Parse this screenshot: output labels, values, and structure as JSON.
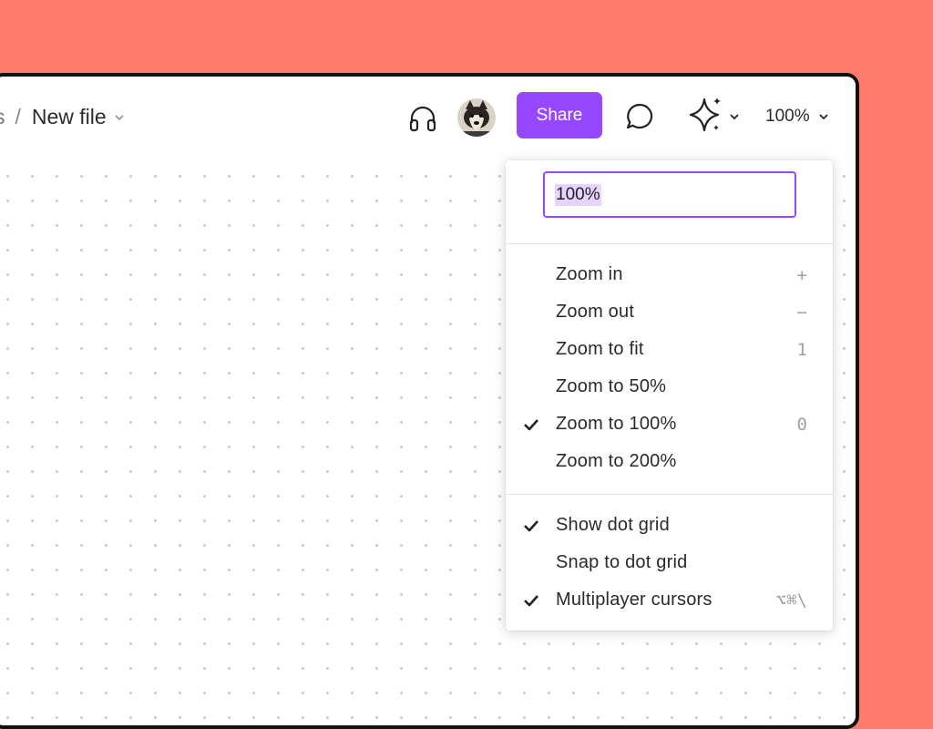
{
  "breadcrumb": {
    "previous": "s",
    "separator": "/",
    "file_name": "New file",
    "chevron_icon": "chevron-down-icon"
  },
  "toolbar": {
    "headphones_icon": "headphones-icon",
    "avatar_icon": "shiba-dog-avatar",
    "share_label": "Share",
    "comment_icon": "comment-bubble-icon",
    "ai_icon": "sparkle-icon",
    "zoom_value": "100%"
  },
  "colors": {
    "background": "#FF7B6B",
    "accent": "#9747FF",
    "selection": "#E6D4FF"
  },
  "zoom_menu": {
    "input_value": "100%",
    "zoom_items": [
      {
        "label": "Zoom in",
        "shortcut": "+",
        "checked": false
      },
      {
        "label": "Zoom out",
        "shortcut": "−",
        "checked": false
      },
      {
        "label": "Zoom to fit",
        "shortcut": "1",
        "checked": false
      },
      {
        "label": "Zoom to 50%",
        "shortcut": "",
        "checked": false
      },
      {
        "label": "Zoom to 100%",
        "shortcut": "0",
        "checked": true
      },
      {
        "label": "Zoom to 200%",
        "shortcut": "",
        "checked": false
      }
    ],
    "option_items": [
      {
        "label": "Show dot grid",
        "shortcut": "",
        "checked": true
      },
      {
        "label": "Snap to dot grid",
        "shortcut": "",
        "checked": false
      },
      {
        "label": "Multiplayer cursors",
        "shortcut": "⌥⌘\\",
        "checked": true
      }
    ]
  }
}
